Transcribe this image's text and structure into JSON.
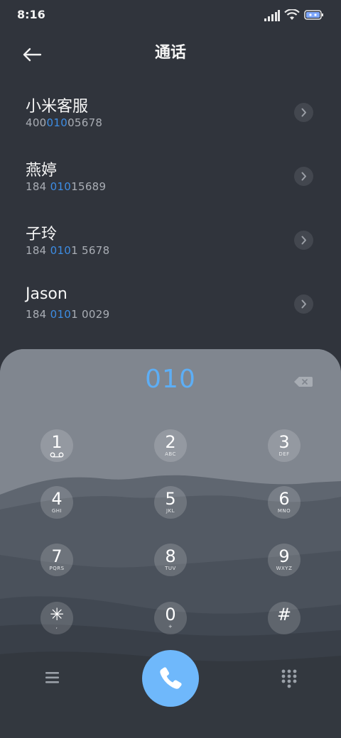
{
  "status_bar": {
    "time": "8:16",
    "icons": [
      "signal-icon",
      "wifi-icon",
      "battery-icon"
    ]
  },
  "header": {
    "title": "通话",
    "back_icon": "back-arrow-icon"
  },
  "contacts": [
    {
      "name": "小米客服",
      "number_pre": "400",
      "number_match": "010",
      "number_post": "05678"
    },
    {
      "name": "燕婷",
      "number_pre": "184 ",
      "number_match": "010",
      "number_post": "15689"
    },
    {
      "name": "子玲",
      "number_pre": "184 ",
      "number_match": "010",
      "number_post": "1 5678"
    },
    {
      "name": "Jason",
      "number_pre": "184 ",
      "number_match": "010",
      "number_post": "1 0029"
    }
  ],
  "dialer": {
    "entered_digits": "010",
    "keys": [
      {
        "digit": "1",
        "sub": ""
      },
      {
        "digit": "2",
        "sub": "ABC"
      },
      {
        "digit": "3",
        "sub": "DEF"
      },
      {
        "digit": "4",
        "sub": "GHI"
      },
      {
        "digit": "5",
        "sub": "JKL"
      },
      {
        "digit": "6",
        "sub": "MNO"
      },
      {
        "digit": "7",
        "sub": "PQRS"
      },
      {
        "digit": "8",
        "sub": "TUV"
      },
      {
        "digit": "9",
        "sub": "WXYZ"
      },
      {
        "digit": "✳",
        "sub": ","
      },
      {
        "digit": "0",
        "sub": "+"
      },
      {
        "digit": "#",
        "sub": ""
      }
    ]
  },
  "colors": {
    "background": "#30343c",
    "accent_blue": "#3d8de4",
    "call_button": "#6fb8fb",
    "digits": "#5daef5"
  }
}
